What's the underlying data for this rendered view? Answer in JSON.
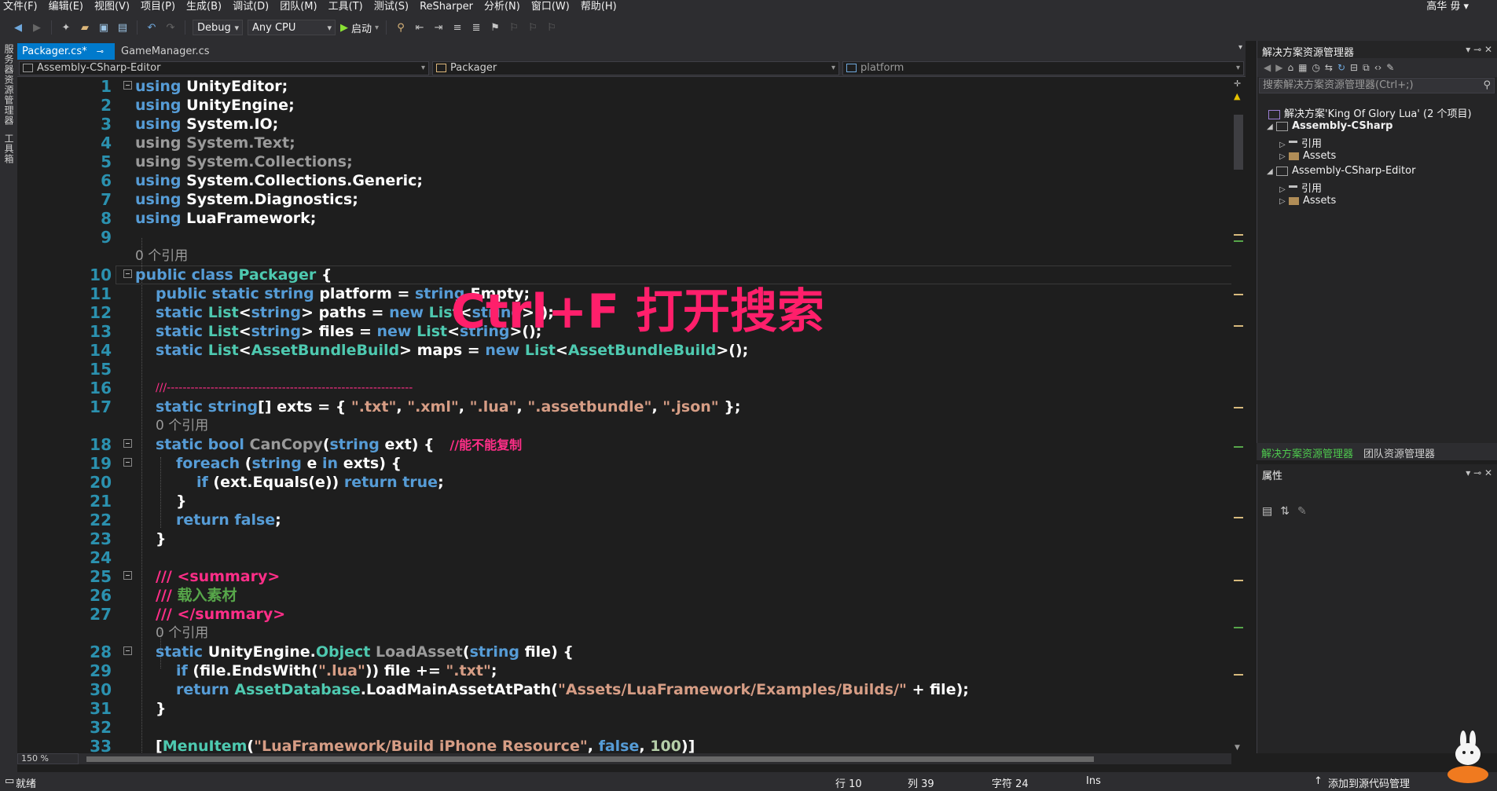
{
  "menu": [
    "文件(F)",
    "编辑(E)",
    "视图(V)",
    "项目(P)",
    "生成(B)",
    "调试(D)",
    "团队(M)",
    "工具(T)",
    "测试(S)",
    "ReSharper",
    "分析(N)",
    "窗口(W)",
    "帮助(H)"
  ],
  "user": "高华 毋 ▾",
  "toolbar": {
    "config": "Debug",
    "platform": "Any CPU",
    "start_label": "启动"
  },
  "left_strip": [
    "服务器资源管理器",
    "工具箱"
  ],
  "tabs": [
    {
      "label": "Packager.cs*",
      "active": true
    },
    {
      "label": "GameManager.cs",
      "active": false
    }
  ],
  "nav": {
    "project": "Assembly-CSharp-Editor",
    "type": "Packager",
    "member": "platform"
  },
  "overlay_text": "Ctrl+F 打开搜索",
  "code_lines": [
    {
      "n": "1"
    },
    {
      "n": "2"
    },
    {
      "n": "3"
    },
    {
      "n": "4"
    },
    {
      "n": "5"
    },
    {
      "n": "6"
    },
    {
      "n": "7"
    },
    {
      "n": "8"
    },
    {
      "n": "9"
    },
    {
      "n": "10"
    },
    {
      "n": "11"
    },
    {
      "n": "12"
    },
    {
      "n": "13"
    },
    {
      "n": "14"
    },
    {
      "n": "15"
    },
    {
      "n": "16"
    },
    {
      "n": "17"
    },
    {
      "n": "18"
    },
    {
      "n": "19"
    },
    {
      "n": "20"
    },
    {
      "n": "21"
    },
    {
      "n": "22"
    },
    {
      "n": "23"
    },
    {
      "n": "24"
    },
    {
      "n": "25"
    },
    {
      "n": "26"
    },
    {
      "n": "27"
    },
    {
      "n": "28"
    },
    {
      "n": "29"
    },
    {
      "n": "30"
    },
    {
      "n": "31"
    },
    {
      "n": "32"
    },
    {
      "n": "33"
    }
  ],
  "code": {
    "l1": [
      "using",
      " UnityEditor;"
    ],
    "l2": [
      "using",
      " UnityEngine;"
    ],
    "l3": [
      "using",
      " System.IO;"
    ],
    "l4": [
      "using",
      " System.Text;"
    ],
    "l5": [
      "using",
      " System.Collections;"
    ],
    "l6": [
      "using",
      " System.Collections.Generic;"
    ],
    "l7": [
      "using",
      " System.Diagnostics;"
    ],
    "l8": [
      "using",
      " LuaFramework;"
    ],
    "lens": "0 个引用",
    "l10": [
      "public class ",
      "Packager",
      " {"
    ],
    "l11": [
      "public static string",
      " platform = ",
      "string",
      ".Empty;"
    ],
    "l12": [
      "static ",
      "List",
      "<",
      "string",
      "> paths = ",
      "new ",
      "List",
      "<",
      "string",
      ">();"
    ],
    "l13": [
      "static ",
      "List",
      "<",
      "string",
      "> files = ",
      "new ",
      "List",
      "<",
      "string",
      ">();"
    ],
    "l14": [
      "static ",
      "List",
      "<",
      "AssetBundleBuild",
      "> maps = ",
      "new ",
      "List",
      "<",
      "AssetBundleBuild",
      ">();"
    ],
    "l16": "///--------------------------------------------------------------",
    "l17": [
      "static string",
      "[] exts = { ",
      "\".txt\"",
      ", ",
      "\".xml\"",
      ", ",
      "\".lua\"",
      ", ",
      "\".assetbundle\"",
      ", ",
      "\".json\"",
      " };"
    ],
    "l18": [
      "static bool ",
      "CanCopy",
      "(",
      "string",
      " ext) {   ",
      "//能不能复制"
    ],
    "l19": [
      "foreach",
      " (",
      "string",
      " e ",
      "in",
      " exts) {"
    ],
    "l20": [
      "if",
      " (ext.Equals(e)) ",
      "return true",
      ";"
    ],
    "l21": "}",
    "l22": [
      "return false",
      ";"
    ],
    "l23": "}",
    "l25": [
      "/// ",
      "<summary>"
    ],
    "l26": [
      "/// ",
      "载入素材"
    ],
    "l27": [
      "/// ",
      "</summary>"
    ],
    "l28": [
      "static ",
      "UnityEngine",
      ".",
      "Object",
      " ",
      "LoadAsset",
      "(",
      "string",
      " file) {"
    ],
    "l29": [
      "if",
      " (file.EndsWith(",
      "\".lua\"",
      ")) file += ",
      "\".txt\"",
      ";"
    ],
    "l30": [
      "return ",
      "AssetDatabase",
      ".LoadMainAssetAtPath(",
      "\"Assets/LuaFramework/Examples/Builds/\"",
      " + file);"
    ],
    "l31": "}",
    "l33": [
      "[",
      "MenuItem",
      "(",
      "\"LuaFramework/Build iPhone Resource\"",
      ", ",
      "false",
      ", ",
      "100",
      ")]"
    ]
  },
  "zoom": "150 %",
  "solution_explorer": {
    "title": "解决方案资源管理器",
    "search_placeholder": "搜索解决方案资源管理器(Ctrl+;)",
    "root": "解决方案'King Of Glory Lua' (2 个项目)",
    "items": [
      {
        "label": "Assembly-CSharp"
      },
      {
        "label": "引用"
      },
      {
        "label": "Assets"
      },
      {
        "label": "Assembly-CSharp-Editor"
      },
      {
        "label": "引用"
      },
      {
        "label": "Assets"
      }
    ]
  },
  "panel_tabs": [
    "解决方案资源管理器",
    "团队资源管理器"
  ],
  "properties_title": "属性",
  "status": {
    "ready": "就绪",
    "row": "行 10",
    "col": "列 39",
    "char": "字符 24",
    "ins": "Ins",
    "source_control": "添加到源代码管理"
  },
  "colors": {
    "accent": "#007acc",
    "keyword": "#569cd6",
    "type": "#4ec9b0",
    "string": "#d69d85",
    "overlay": "#ff1f6b"
  }
}
